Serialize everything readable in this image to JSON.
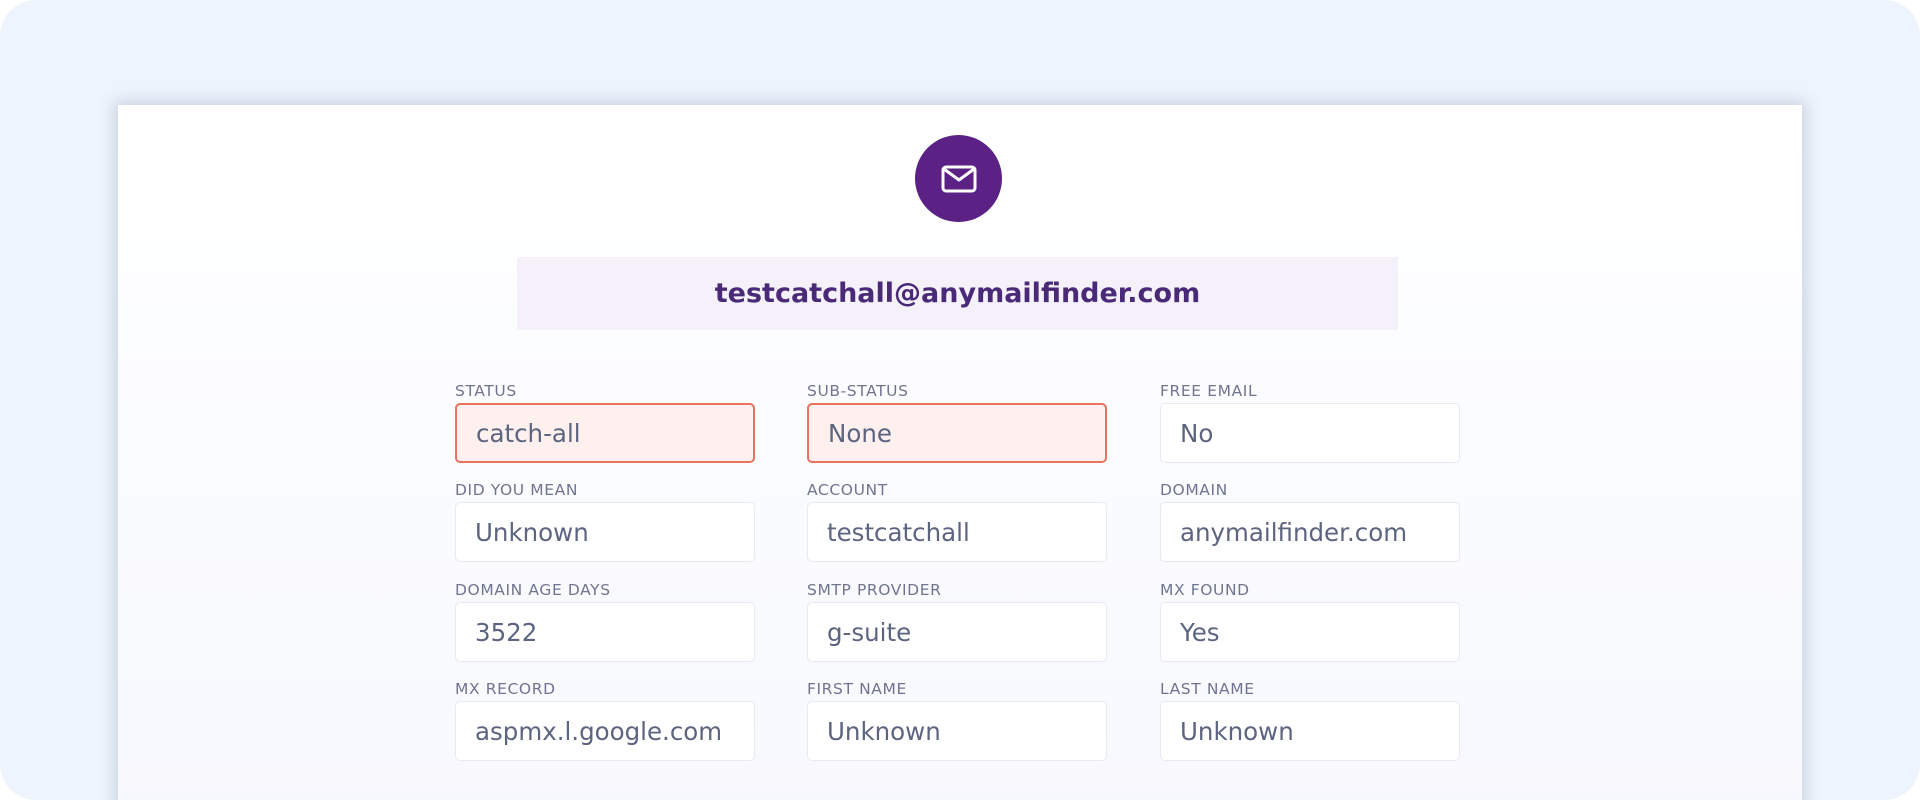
{
  "email": "testcatchall@anymailfinder.com",
  "icons": {
    "avatar": "envelope-icon"
  },
  "colors": {
    "accent": "#5b2185",
    "error_border": "#e9735f",
    "error_bg": "#fdf0ee"
  },
  "fields": {
    "status": {
      "label": "STATUS",
      "value": "catch-all",
      "state": "error"
    },
    "sub_status": {
      "label": "SUB-STATUS",
      "value": "None",
      "state": "error"
    },
    "free_email": {
      "label": "FREE EMAIL",
      "value": "No"
    },
    "did_you_mean": {
      "label": "DID YOU MEAN",
      "value": "Unknown"
    },
    "account": {
      "label": "ACCOUNT",
      "value": "testcatchall"
    },
    "domain": {
      "label": "DOMAIN",
      "value": "anymailfinder.com"
    },
    "domain_age_days": {
      "label": "DOMAIN AGE DAYS",
      "value": "3522"
    },
    "smtp_provider": {
      "label": "SMTP PROVIDER",
      "value": "g-suite"
    },
    "mx_found": {
      "label": "MX FOUND",
      "value": "Yes"
    },
    "mx_record": {
      "label": "MX RECORD",
      "value": "aspmx.l.google.com"
    },
    "first_name": {
      "label": "FIRST NAME",
      "value": "Unknown"
    },
    "last_name": {
      "label": "LAST NAME",
      "value": "Unknown"
    }
  }
}
